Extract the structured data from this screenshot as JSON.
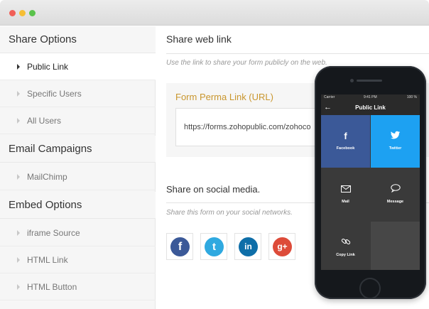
{
  "sidebar": {
    "sections": [
      {
        "title": "Share Options",
        "items": [
          {
            "label": "Public Link",
            "active": true
          },
          {
            "label": "Specific Users"
          },
          {
            "label": "All Users"
          }
        ]
      },
      {
        "title": "Email Campaigns",
        "items": [
          {
            "label": "MailChimp"
          }
        ]
      },
      {
        "title": "Embed Options",
        "items": [
          {
            "label": "iframe Source"
          },
          {
            "label": "HTML Link"
          },
          {
            "label": "HTML Button"
          }
        ]
      }
    ]
  },
  "main": {
    "title": "Share web link",
    "hint": "Use the link to share your form publicly on the web.",
    "perma_label": "Form Perma Link (URL)",
    "perma_value": "https://forms.zohopublic.com/zohoco",
    "social_title": "Share on social media.",
    "social_hint": "Share this form on your social networks.",
    "social_buttons": [
      {
        "name": "facebook",
        "glyph": "f",
        "color": "#3b5998"
      },
      {
        "name": "twitter",
        "glyph": "t",
        "color": "#2fa9e0"
      },
      {
        "name": "linkedin",
        "glyph": "in",
        "color": "#0e6ea8"
      },
      {
        "name": "google-plus",
        "glyph": "g+",
        "color": "#dd4b39"
      }
    ]
  },
  "phone": {
    "status": {
      "carrier": "Carrier",
      "time": "9:41 PM",
      "battery": "100 %"
    },
    "appbar_title": "Public Link",
    "tiles": [
      {
        "label": "Facebook",
        "icon": "f",
        "color": "#3b5998"
      },
      {
        "label": "Twitter",
        "icon": "bird",
        "color": "#1da1f2"
      },
      {
        "label": "Mail",
        "icon": "envelope",
        "color": "#3a3a3a"
      },
      {
        "label": "Message",
        "icon": "chat-bubble",
        "color": "#3a3a3a"
      },
      {
        "label": "Copy Link",
        "icon": "link",
        "color": "#3a3a3a"
      },
      {
        "label": "",
        "icon": "",
        "color": "#474747"
      }
    ]
  }
}
